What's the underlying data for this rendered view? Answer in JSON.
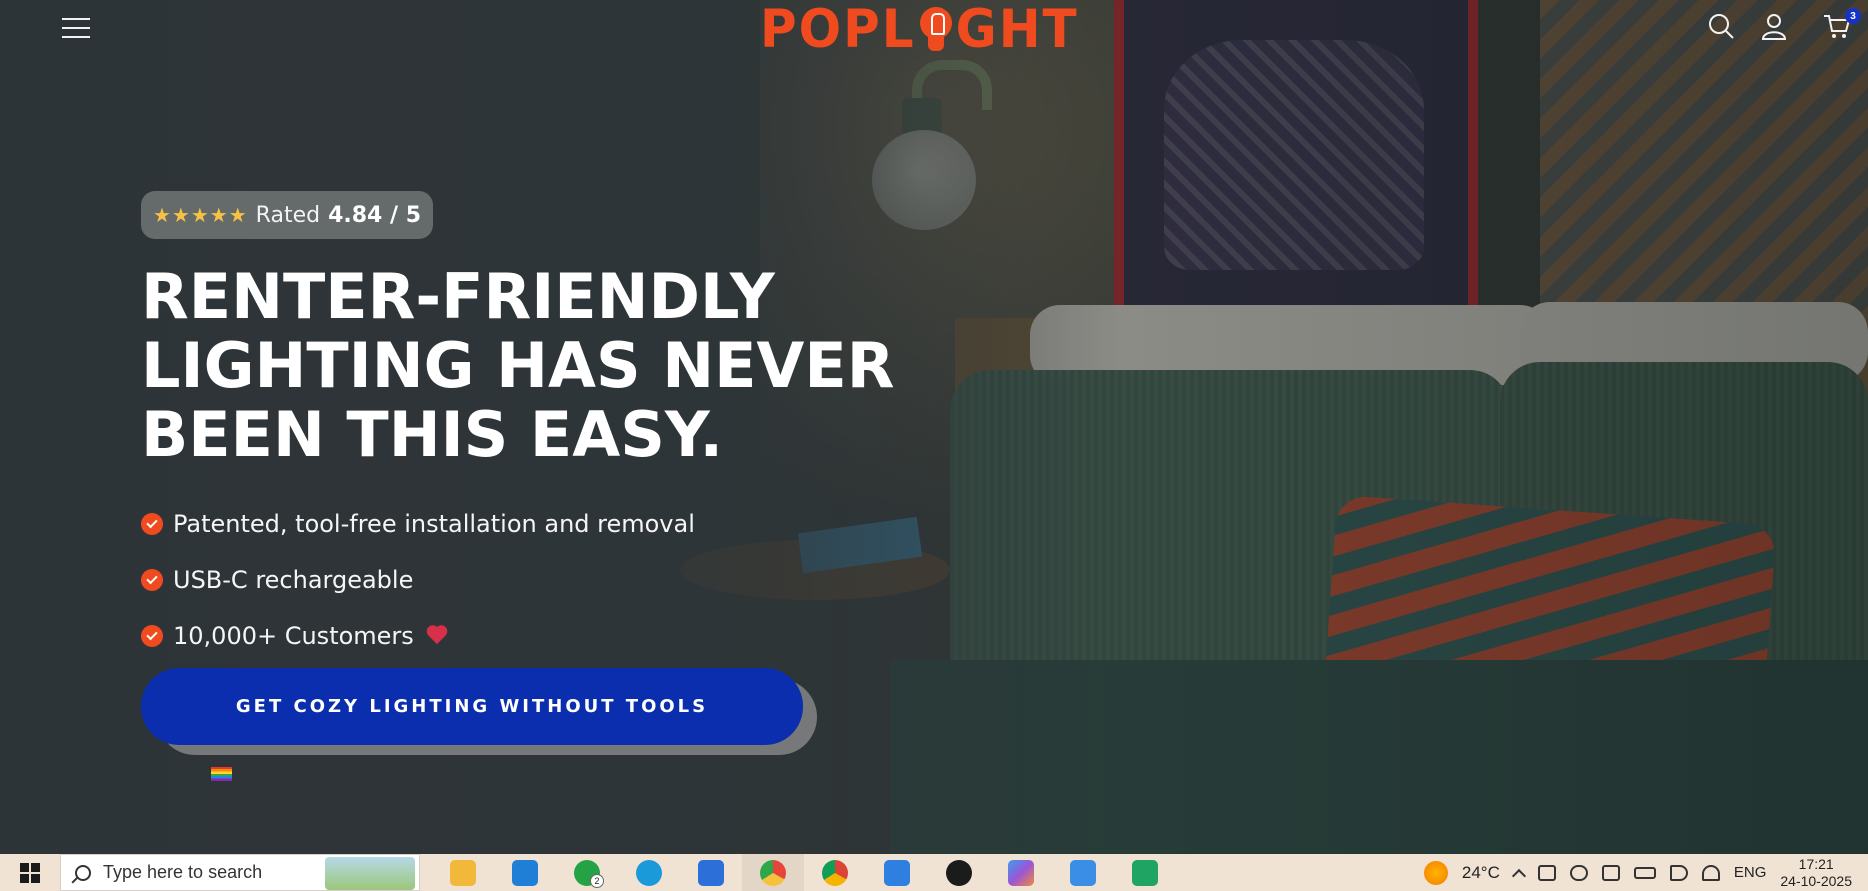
{
  "header": {
    "logo_text_left": "POPL",
    "logo_text_right": "GHT",
    "cart_count": "3"
  },
  "hero": {
    "rating": {
      "stars": "★★★★★",
      "label": "Rated",
      "value": "4.84 / 5"
    },
    "headline_lines": [
      "RENTER-FRIENDLY",
      "LIGHTING HAS NEVER",
      "BEEN THIS EASY."
    ],
    "features": [
      "Patented, tool-free installation and removal",
      "USB-C rechargeable",
      "10,000+ Customers"
    ],
    "cta_label": "GET COZY LIGHTING WITHOUT TOOLS"
  },
  "taskbar": {
    "search_placeholder": "Type here to search",
    "whatsapp_badge": "2",
    "weather_temp": "24°C",
    "language": "ENG",
    "time": "17:21",
    "date": "24-10-2025",
    "apps": [
      {
        "name": "file-explorer",
        "color": "#f2b83a"
      },
      {
        "name": "vscode",
        "color": "#1f7fd6"
      },
      {
        "name": "whatsapp",
        "color": "#25a244"
      },
      {
        "name": "edge",
        "color": "#1a9ad8"
      },
      {
        "name": "docs",
        "color": "#2d6fd8"
      },
      {
        "name": "chrome",
        "color": "#e6453a"
      },
      {
        "name": "chrome-profile",
        "color": "#db4437"
      },
      {
        "name": "ms-store",
        "color": "#2f7fe0"
      },
      {
        "name": "upwork",
        "color": "#1b1b1b"
      },
      {
        "name": "copilot",
        "color": "#9a55d6"
      },
      {
        "name": "photos",
        "color": "#3a8ee6"
      },
      {
        "name": "sheets",
        "color": "#1fa463"
      }
    ]
  },
  "colors": {
    "brand": "#f04b1f",
    "cta": "#0a2eae",
    "star": "#f7c243"
  }
}
